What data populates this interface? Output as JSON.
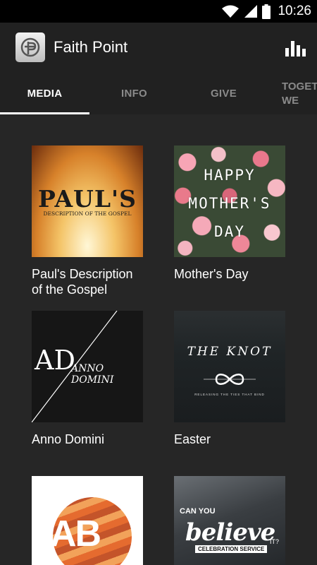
{
  "status_bar": {
    "time": "10:26"
  },
  "app_bar": {
    "title": "Faith Point",
    "stats_icon": "bar-chart-icon"
  },
  "tabs": [
    {
      "label": "MEDIA",
      "active": true
    },
    {
      "label": "INFO",
      "active": false
    },
    {
      "label": "GIVE",
      "active": false
    },
    {
      "label": "TOGET\nWE",
      "active": false
    }
  ],
  "media": [
    {
      "title": "Paul's Description of the Gospel",
      "art_main": "PAUL'S",
      "art_sub": "DESCRIPTION OF THE GOSPEL"
    },
    {
      "title": "Mother's Day",
      "art_text": "HAPPY\nMOTHER'S\nDAY"
    },
    {
      "title": "Anno Domini",
      "art_main": "AD",
      "art_sub": "ANNO DOMINI"
    },
    {
      "title": "Easter",
      "art_main": "THE KNOT",
      "art_sub": "RELEASING THE TIES THAT BIND"
    },
    {
      "title": "",
      "art_main": "AB"
    },
    {
      "title": "",
      "art_top": "CAN YOU",
      "art_main": "believe",
      "art_it": "IT?",
      "art_sub": "CELEBRATION SERVICE"
    }
  ],
  "colors": {
    "background": "#262626",
    "app_bar": "#212121",
    "status_bar": "#000000",
    "tab_active": "#ffffff",
    "tab_inactive": "#8a8a8a"
  }
}
